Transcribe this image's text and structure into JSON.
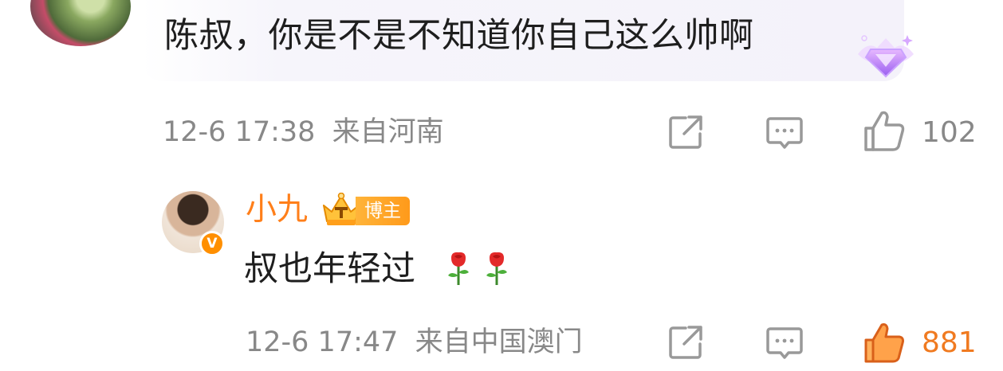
{
  "comments": [
    {
      "text": "陈叔，你是不是不知道你自己这么帅啊",
      "time": "12-6 17:38",
      "location": "来自河南",
      "like_count": "102",
      "liked": false
    },
    {
      "username": "小九",
      "role_tag": "博主",
      "text": "叔也年轻过",
      "time": "12-6 17:47",
      "location": "来自中国澳门",
      "like_count": "881",
      "liked": true,
      "verified_mark": "V"
    }
  ],
  "colors": {
    "username": "#ff7f1a",
    "liked": "#f07a20",
    "meta": "#888888",
    "tag_bg": "#ffa52a"
  },
  "icons": [
    "share-icon",
    "comment-icon",
    "like-icon",
    "rose-emoji-icon",
    "crown-badge-icon",
    "diamond-badge-icon"
  ]
}
